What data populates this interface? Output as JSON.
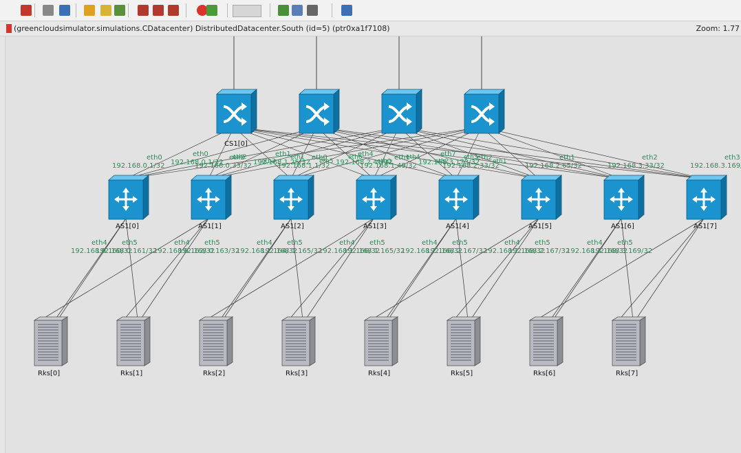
{
  "toolbar": {
    "icons": [
      {
        "name": "run-icon",
        "color": "#c0392b"
      },
      {
        "name": "step-icon",
        "color": "#888888"
      },
      {
        "name": "inspect-icon",
        "color": "#3b6fb6"
      },
      {
        "name": "info-icon",
        "color": "#e0a020"
      },
      {
        "name": "find-icon",
        "color": "#d9b23a"
      },
      {
        "name": "module-tree-icon",
        "color": "#5a8f3c"
      },
      {
        "name": "undo-icon",
        "color": "#b03a2e"
      },
      {
        "name": "redo-icon",
        "color": "#b03a2e"
      },
      {
        "name": "run-until-icon",
        "color": "#b03a2e"
      },
      {
        "name": "stop-icon",
        "color": "#d9342b"
      },
      {
        "name": "refresh-icon",
        "color": "#4a9a3a"
      },
      {
        "name": "zoom-in-icon",
        "color": "#4a8f3a"
      },
      {
        "name": "zoom-out-icon",
        "color": "#5a7fb6"
      },
      {
        "name": "labels-icon",
        "color": "#666666"
      },
      {
        "name": "arrow-icon",
        "color": "#3b6fb6"
      }
    ]
  },
  "infobar": {
    "text": "(greencloudsimulator.simulations.CDatacenter) DistributedDatacenter.South  (id=5)  (ptr0xa1f7108)",
    "zoom": "Zoom: 1.77"
  },
  "colors": {
    "switch_fill": "#1a93cf",
    "switch_top": "#6cc6ef",
    "switch_side": "#0f6f9f",
    "port_label": "#2e8b57",
    "link": "#444444"
  },
  "core_switches": [
    {
      "label": "CS1[0]",
      "ports": [
        {
          "if": "eth0",
          "addr": "192.168.0.1/32"
        }
      ]
    },
    {
      "label": "",
      "ports": [
        {
          "if": "eth1",
          "addr": "192.168.1.25/32"
        }
      ]
    },
    {
      "label": "",
      "ports": [
        {
          "if": "eth4",
          "addr": "192.168.2.41/32"
        }
      ]
    },
    {
      "label": "",
      "ports": [
        {
          "if": "eth7",
          "addr": "192.168.3.173/32"
        }
      ]
    }
  ],
  "agg_switches": [
    {
      "label": "AS1[0]",
      "up": {
        "if": "eth0",
        "addr": "192.168.0.1/32"
      },
      "down": [
        {
          "if": "eth4",
          "addr": "192.168.0.160/32"
        },
        {
          "if": "eth5",
          "addr": "192.168.0.161/32"
        }
      ]
    },
    {
      "label": "AS1[1]",
      "up": {
        "if": "eth2",
        "addr": "192.168.0.33/32"
      },
      "down": [
        {
          "if": "eth4",
          "addr": "192.168.0.162/32"
        },
        {
          "if": "eth5",
          "addr": "192.168.0.163/32"
        }
      ]
    },
    {
      "label": "AS1[2]",
      "up": {
        "if": "eth0",
        "addr": "192.168.1.1/32"
      },
      "down": [
        {
          "if": "eth4",
          "addr": "192.168.1.164/32"
        },
        {
          "if": "eth5",
          "addr": "192.168.1.165/32"
        }
      ]
    },
    {
      "label": "AS1[3]",
      "up": {
        "if": "eth1",
        "addr": "192.168.1.49/32"
      },
      "down": [
        {
          "if": "eth4",
          "addr": "192.168.1.166/32"
        },
        {
          "if": "eth5",
          "addr": "192.168.1.165/32"
        }
      ]
    },
    {
      "label": "AS1[4]",
      "up": {
        "if": "eth2",
        "addr": "192.168.2.33/32"
      },
      "down": [
        {
          "if": "eth4",
          "addr": "192.168.2.166/32"
        },
        {
          "if": "eth5",
          "addr": "192.168.2.167/32"
        }
      ]
    },
    {
      "label": "AS1[5]",
      "up": {
        "if": "eth1",
        "addr": "192.168.2.65/32"
      },
      "down": [
        {
          "if": "eth4",
          "addr": "192.168.2.168/32"
        },
        {
          "if": "eth5",
          "addr": "192.168.2.167/32"
        }
      ]
    },
    {
      "label": "AS1[6]",
      "up": {
        "if": "eth2",
        "addr": "192.168.3.33/32"
      },
      "down": [
        {
          "if": "eth4",
          "addr": "192.168.3.168/32"
        },
        {
          "if": "eth5",
          "addr": "192.168.3.169/32"
        }
      ]
    },
    {
      "label": "AS1[7]",
      "up": {
        "if": "eth3",
        "addr": "192.168.3.169/32"
      },
      "down": []
    }
  ],
  "racks": [
    {
      "label": "Rks[0]"
    },
    {
      "label": "Rks[1]"
    },
    {
      "label": "Rks[2]"
    },
    {
      "label": "Rks[3]"
    },
    {
      "label": "Rks[4]"
    },
    {
      "label": "Rks[5]"
    },
    {
      "label": "Rks[6]"
    },
    {
      "label": "Rks[7]"
    }
  ],
  "cursor": "➤"
}
